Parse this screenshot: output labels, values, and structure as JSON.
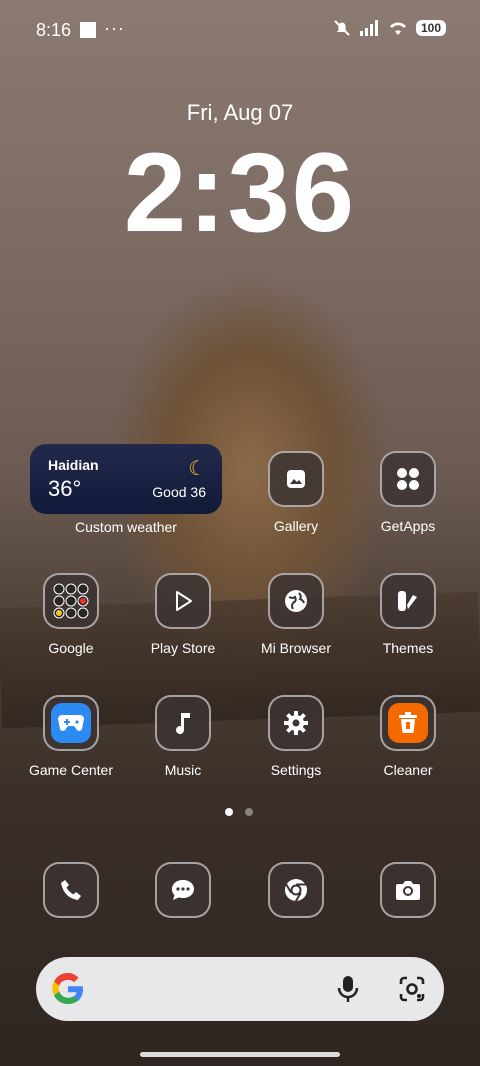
{
  "status": {
    "time": "8:16",
    "dots": "···",
    "battery": "100"
  },
  "lock": {
    "date": "Fri, Aug 07",
    "clock": "2:36"
  },
  "weather": {
    "city": "Haidian",
    "temp": "36°",
    "aq": "Good 36",
    "label": "Custom weather"
  },
  "apps": {
    "gallery": "Gallery",
    "getapps": "GetApps",
    "google": "Google",
    "playstore": "Play Store",
    "browser": "Mi Browser",
    "themes": "Themes",
    "gamecenter": "Game Center",
    "music": "Music",
    "settings": "Settings",
    "cleaner": "Cleaner"
  },
  "colors": {
    "accent_cleaner": "#f56a00",
    "game_blue": "#2b8bf2"
  }
}
